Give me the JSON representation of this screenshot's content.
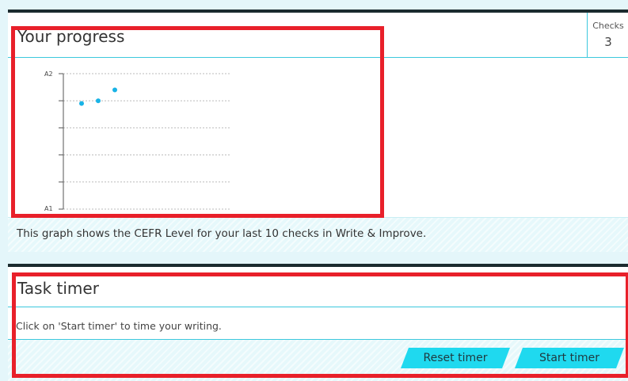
{
  "progress": {
    "title": "Your progress",
    "checks_label": "Checks",
    "checks_value": "3",
    "caption": "This graph shows the CEFR Level for your last 10 checks in Write & Improve."
  },
  "chart_data": {
    "type": "scatter",
    "title": "",
    "xlabel": "",
    "ylabel": "",
    "y_tick_labels": [
      "A1",
      "A2"
    ],
    "ylim": [
      0,
      5
    ],
    "grid": true,
    "x": [
      1,
      2,
      3
    ],
    "y": [
      3.9,
      4.0,
      4.4
    ],
    "point_color": "#19b3e6"
  },
  "timer": {
    "title": "Task timer",
    "instruction": "Click on 'Start timer' to time your writing.",
    "reset_label": "Reset timer",
    "start_label": "Start timer"
  },
  "colors": {
    "accent": "#1fd9ef",
    "border": "#3cc8dd",
    "highlight": "#e8202a",
    "panel_top": "#1b2b2f"
  }
}
